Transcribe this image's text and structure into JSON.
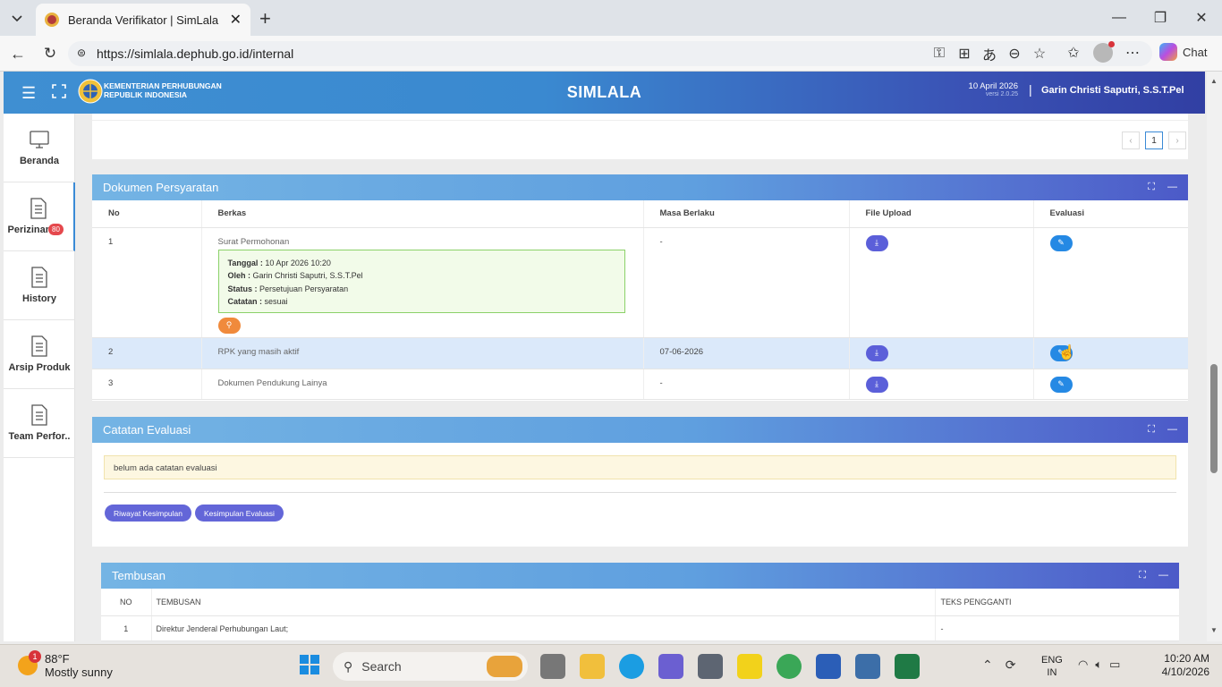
{
  "browser": {
    "tab_title": "Beranda Verifikator | SimLala",
    "url": "https://simlala.dephub.go.id/internal",
    "chat_label": "Chat"
  },
  "header": {
    "org_line1": "KEMENTERIAN PERHUBUNGAN",
    "org_line2": "REPUBLIK INDONESIA",
    "app_name": "SIMLALA",
    "date": "10 April 2026",
    "version": "versi 2.0.25",
    "user": "Garin Christi Saputri, S.S.T.Pel"
  },
  "sidebar": {
    "items": [
      {
        "label": "Beranda"
      },
      {
        "label": "Perizinan",
        "badge": "80"
      },
      {
        "label": "History"
      },
      {
        "label": "Arsip Produk"
      },
      {
        "label": "Team Perfor.."
      }
    ]
  },
  "pagination": {
    "prev": "‹",
    "current": "1",
    "next": "›"
  },
  "dokumen": {
    "title": "Dokumen Persyaratan",
    "columns": [
      "No",
      "Berkas",
      "Masa Berlaku",
      "File Upload",
      "Evaluasi"
    ],
    "rows": [
      {
        "no": "1",
        "berkas": "Surat Permohonan",
        "masa": "-",
        "detail": {
          "tanggal_label": "Tanggal :",
          "tanggal": "10 Apr 2026 10:20",
          "oleh_label": "Oleh :",
          "oleh": "Garin Christi Saputri, S.S.T.Pel",
          "status_label": "Status :",
          "status": "Persetujuan Persyaratan",
          "catatan_label": "Catatan :",
          "catatan": "sesuai"
        }
      },
      {
        "no": "2",
        "berkas": "RPK yang masih aktif",
        "masa": "07-06-2026"
      },
      {
        "no": "3",
        "berkas": "Dokumen Pendukung Lainya",
        "masa": "-"
      }
    ]
  },
  "catatan": {
    "title": "Catatan Evaluasi",
    "message": "belum ada catatan evaluasi",
    "btn_riwayat": "Riwayat Kesimpulan",
    "btn_kesimpulan": "Kesimpulan Evaluasi"
  },
  "tembusan": {
    "title": "Tembusan",
    "columns": [
      "NO",
      "TEMBUSAN",
      "TEKS PENGGANTI"
    ],
    "rows": [
      {
        "no": "1",
        "tembusan": "Direktur Jenderal Perhubungan Laut;",
        "teks": "-"
      }
    ]
  },
  "taskbar": {
    "weather_temp": "88°F",
    "weather_desc": "Mostly sunny",
    "weather_badge": "1",
    "search_placeholder": "Search",
    "lang_line1": "ENG",
    "lang_line2": "IN",
    "time": "10:20 AM",
    "date": "4/10/2026"
  }
}
